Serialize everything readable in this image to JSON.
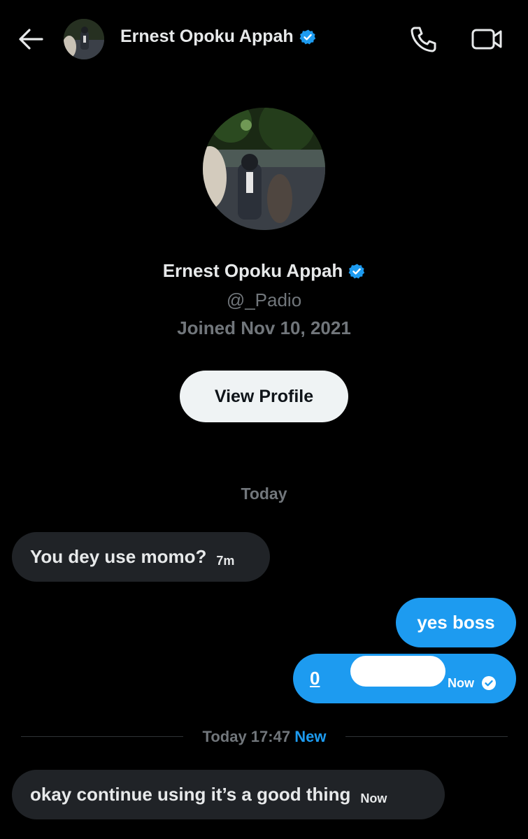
{
  "header": {
    "name": "Ernest Opoku Appah",
    "icons": {
      "back": "arrow-left-icon",
      "verified": "verified-badge-icon",
      "call": "phone-icon",
      "video": "video-camera-icon"
    }
  },
  "profile": {
    "name": "Ernest Opoku Appah",
    "handle": "@_Padio",
    "joined": "Joined Nov 10, 2021",
    "view_profile_label": "View Profile"
  },
  "conversation": {
    "date_label": "Today",
    "messages": [
      {
        "direction": "incoming",
        "text": "You dey use momo?",
        "time": "7m"
      },
      {
        "direction": "outgoing",
        "text": "yes boss",
        "time": ""
      },
      {
        "direction": "outgoing",
        "text": "0",
        "time": "Now",
        "status": "read-check-icon"
      },
      {
        "direction": "incoming",
        "text": "okay continue using it’s a good thing",
        "time": "Now"
      }
    ],
    "new_divider": {
      "date": "Today 17:47",
      "label": "New"
    }
  },
  "colors": {
    "background": "#000000",
    "accent": "#1d9bf0",
    "incoming_bubble": "#202327",
    "secondary_text": "#71767b",
    "button_bg": "#eff3f4"
  }
}
